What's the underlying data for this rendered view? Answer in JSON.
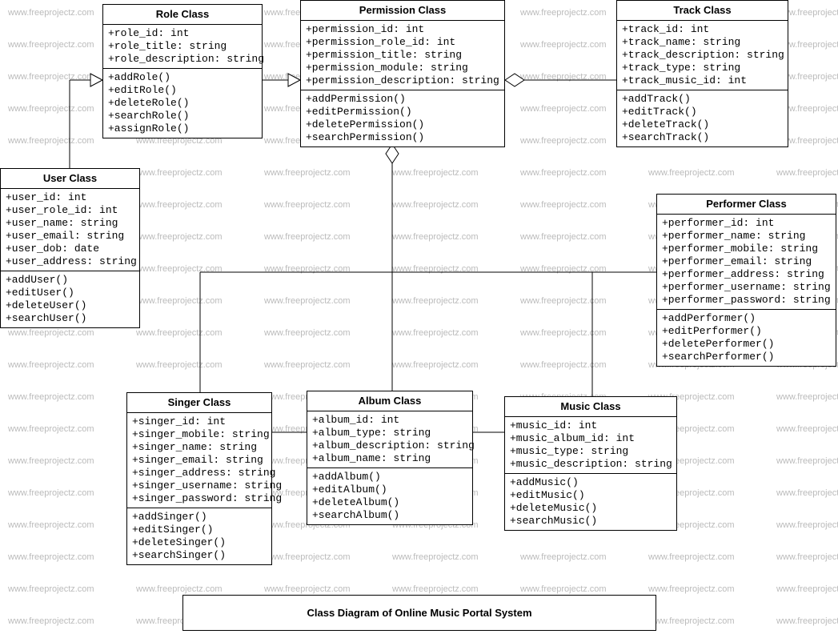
{
  "watermark_text": "www.freeprojectz.com",
  "diagram_title": "Class Diagram of Online Music Portal System",
  "classes": {
    "role": {
      "title": "Role Class",
      "attrs": [
        "+role_id: int",
        "+role_title: string",
        "+role_description: string"
      ],
      "ops": [
        "+addRole()",
        "+editRole()",
        "+deleteRole()",
        "+searchRole()",
        "+assignRole()"
      ]
    },
    "permission": {
      "title": "Permission Class",
      "attrs": [
        "+permission_id: int",
        "+permission_role_id: int",
        "+permission_title: string",
        "+permission_module: string",
        "+permission_description: string"
      ],
      "ops": [
        "+addPermission()",
        "+editPermission()",
        "+deletePermission()",
        "+searchPermission()"
      ]
    },
    "track": {
      "title": "Track Class",
      "attrs": [
        "+track_id: int",
        "+track_name: string",
        "+track_description: string",
        "+track_type: string",
        "+track_music_id: int"
      ],
      "ops": [
        "+addTrack()",
        "+editTrack()",
        "+deleteTrack()",
        "+searchTrack()"
      ]
    },
    "user": {
      "title": "User Class",
      "attrs": [
        "+user_id: int",
        "+user_role_id: int",
        "+user_name: string",
        "+user_email: string",
        "+user_dob: date",
        "+user_address: string"
      ],
      "ops": [
        "+addUser()",
        "+editUser()",
        "+deleteUser()",
        "+searchUser()"
      ]
    },
    "performer": {
      "title": "Performer Class",
      "attrs": [
        "+performer_id: int",
        "+performer_name: string",
        "+performer_mobile: string",
        "+performer_email: string",
        "+performer_address: string",
        "+performer_username: string",
        "+performer_password: string"
      ],
      "ops": [
        "+addPerformer()",
        "+editPerformer()",
        "+deletePerformer()",
        "+searchPerformer()"
      ]
    },
    "singer": {
      "title": "Singer Class",
      "attrs": [
        "+singer_id: int",
        "+singer_mobile: string",
        "+singer_name: string",
        "+singer_email: string",
        "+singer_address: string",
        "+singer_username: string",
        "+singer_password: string"
      ],
      "ops": [
        "+addSinger()",
        "+editSinger()",
        "+deleteSinger()",
        "+searchSinger()"
      ]
    },
    "album": {
      "title": "Album Class",
      "attrs": [
        "+album_id: int",
        "+album_type: string",
        "+album_description: string",
        "+album_name: string"
      ],
      "ops": [
        "+addAlbum()",
        "+editAlbum()",
        "+deleteAlbum()",
        "+searchAlbum()"
      ]
    },
    "music": {
      "title": "Music Class",
      "attrs": [
        "+music_id: int",
        "+music_album_id: int",
        "+music_type: string",
        "+music_description: string"
      ],
      "ops": [
        "+addMusic()",
        "+editMusic()",
        "+deleteMusic()",
        "+searchMusic()"
      ]
    }
  }
}
